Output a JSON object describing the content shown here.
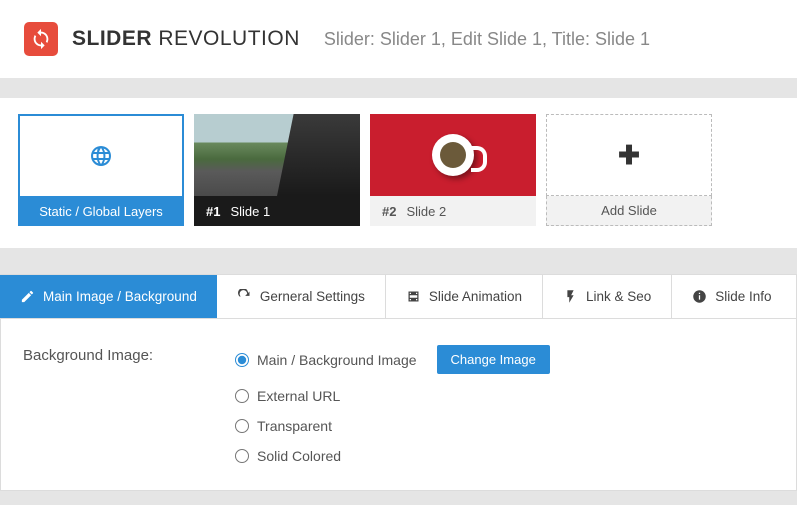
{
  "header": {
    "brand_bold": "SLIDER",
    "brand_light": " REVOLUTION",
    "breadcrumb": "Slider: Slider 1, Edit Slide 1, Title: Slide 1"
  },
  "slides": {
    "static_label": "Static / Global Layers",
    "items": [
      {
        "num": "#1",
        "title": "Slide 1"
      },
      {
        "num": "#2",
        "title": "Slide 2"
      }
    ],
    "add_label": "Add Slide"
  },
  "tabs": {
    "main": "Main Image / Background",
    "general": "Gerneral Settings",
    "animation": "Slide Animation",
    "link": "Link & Seo",
    "info": "Slide Info"
  },
  "form": {
    "label": "Background Image:",
    "options": {
      "main": "Main / Background Image",
      "external": "External URL",
      "transparent": "Transparent",
      "solid": "Solid Colored"
    },
    "change_btn": "Change Image"
  }
}
